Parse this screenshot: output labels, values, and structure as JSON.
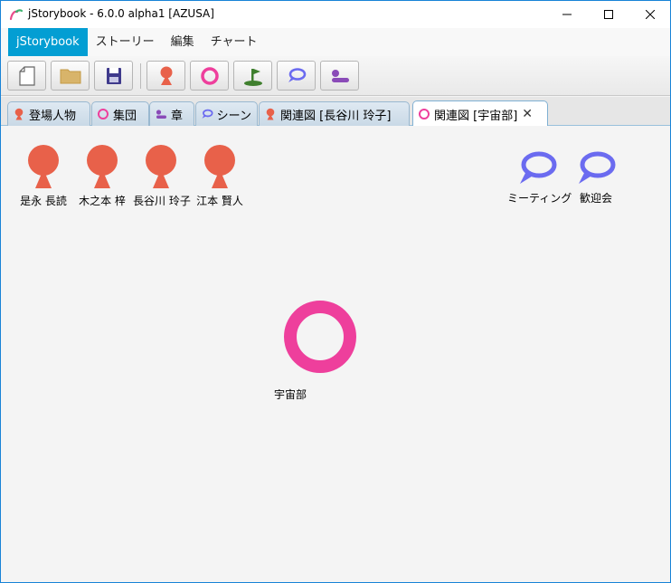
{
  "window": {
    "title": "jStorybook - 6.0.0 alpha1 [AZUSA]"
  },
  "menu": {
    "items": [
      "jStorybook",
      "ストーリー",
      "編集",
      "チャート"
    ]
  },
  "tabs": [
    {
      "label": "登場人物",
      "icon": "person-icon"
    },
    {
      "label": "集団",
      "icon": "group-icon"
    },
    {
      "label": "章",
      "icon": "chapter-icon"
    },
    {
      "label": "シーン",
      "icon": "scene-icon"
    },
    {
      "label": "関連図 [長谷川 玲子]",
      "icon": "person-icon"
    },
    {
      "label": "関連図 [宇宙部]",
      "icon": "group-icon",
      "active": true,
      "close": "✕"
    }
  ],
  "toolbar": {
    "buttons": [
      "new-file-icon",
      "open-folder-icon",
      "save-icon",
      "person-icon",
      "group-icon",
      "place-icon",
      "scene-icon",
      "chapter-icon"
    ]
  },
  "chart": {
    "persons": [
      "是永 長読",
      "木之本 梓",
      "長谷川 玲子",
      "江本 賢人"
    ],
    "scenes": [
      "ミーティング",
      "歓迎会"
    ],
    "group": "宇宙部"
  },
  "colors": {
    "person": "#e8614a",
    "group": "#ee3f9c",
    "scene": "#6b6bf0",
    "chapter": "#8a4bb8",
    "place": "#3f7f2e",
    "accent": "#039ed3"
  }
}
